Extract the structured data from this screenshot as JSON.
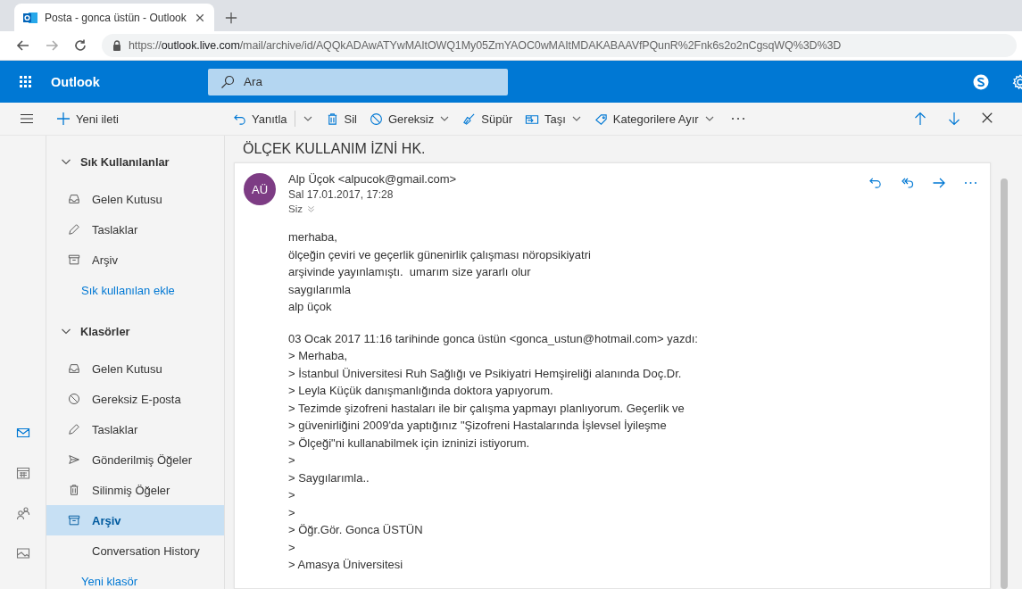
{
  "browser": {
    "tab_title": "Posta - gonca üstün - Outlook",
    "url_scheme": "https://",
    "url_host": "outlook.live.com",
    "url_path": "/mail/archive/id/AQQkADAwATYwMAItOWQ1My05ZmYAOC0wMAItMDAKABAAVfPQunR%2Fnk6s2o2nCgsqWQ%3D%3D"
  },
  "app": {
    "name": "Outlook",
    "search": {
      "placeholder": "Ara"
    }
  },
  "new_message": "Yeni ileti",
  "commands": [
    {
      "kind": "reply",
      "label": "Yanıtla",
      "split": true,
      "menu": false
    },
    {
      "kind": "delete",
      "label": "Sil",
      "split": false,
      "menu": false
    },
    {
      "kind": "junk",
      "label": "Gereksiz",
      "split": false,
      "menu": true
    },
    {
      "kind": "sweep",
      "label": "Süpür",
      "split": false,
      "menu": false
    },
    {
      "kind": "move",
      "label": "Taşı",
      "split": false,
      "menu": true
    },
    {
      "kind": "categorize",
      "label": "Kategorilere Ayır",
      "split": false,
      "menu": true
    }
  ],
  "rail": [
    {
      "kind": "mail",
      "selected": true
    },
    {
      "kind": "calendar",
      "selected": false
    },
    {
      "kind": "people",
      "selected": false
    },
    {
      "kind": "photos",
      "selected": false
    }
  ],
  "folder_groups": [
    {
      "title": "Sık Kullanılanlar",
      "expanded": true,
      "items": [
        {
          "kind": "inbox",
          "label": "Gelen Kutusu",
          "selected": false
        },
        {
          "kind": "drafts",
          "label": "Taslaklar",
          "selected": false
        },
        {
          "kind": "archive",
          "label": "Arşiv",
          "selected": false
        }
      ],
      "link": "Sık kullanılan ekle"
    },
    {
      "title": "Klasörler",
      "expanded": true,
      "items": [
        {
          "kind": "inbox",
          "label": "Gelen Kutusu",
          "selected": false
        },
        {
          "kind": "junk",
          "label": "Gereksiz E-posta",
          "selected": false
        },
        {
          "kind": "drafts",
          "label": "Taslaklar",
          "selected": false
        },
        {
          "kind": "sent",
          "label": "Gönderilmiş Öğeler",
          "selected": false
        },
        {
          "kind": "deleted",
          "label": "Silinmiş Öğeler",
          "selected": false
        },
        {
          "kind": "archive",
          "label": "Arşiv",
          "selected": true
        },
        {
          "kind": "other",
          "label": "Conversation History",
          "selected": false
        }
      ],
      "link": "Yeni klasör"
    }
  ],
  "message": {
    "subject": "ÖLÇEK KULLANIM İZNİ HK.",
    "avatar": {
      "initials": "AÜ",
      "color": "#7d3c84"
    },
    "from": "Alp Üçok <alpucok@gmail.com>",
    "date": "Sal 17.01.2017, 17:28",
    "to": "Siz",
    "paragraphs": [
      [
        "merhaba,",
        "ölçeğin çeviri ve geçerlik günenirlik çalışması nöropsikiyatri",
        "arşivinde yayınlamıştı.  umarım size yararlı olur",
        "saygılarımla",
        "alp üçok"
      ],
      [
        "03 Ocak 2017 11:16 tarihinde gonca üstün <gonca_ustun@hotmail.com> yazdı:",
        "> Merhaba,",
        "> İstanbul Üniversitesi Ruh Sağlığı ve Psikiyatri Hemşireliği alanında Doç.Dr.",
        "> Leyla Küçük danışmanlığında doktora yapıyorum.",
        "> Tezimde şizofreni hastaları ile bir çalışma yapmayı planlıyorum. Geçerlik ve",
        "> güvenirliğini 2009'da yaptığınız \"Şizofreni Hastalarında İşlevsel İyileşme",
        "> Ölçeği\"ni kullanabilmek için izninizi istiyorum.",
        ">",
        "> Saygılarımla..",
        ">",
        ">",
        "> Öğr.Gör. Gonca ÜSTÜN",
        ">",
        "> Amasya Üniversitesi"
      ]
    ]
  }
}
